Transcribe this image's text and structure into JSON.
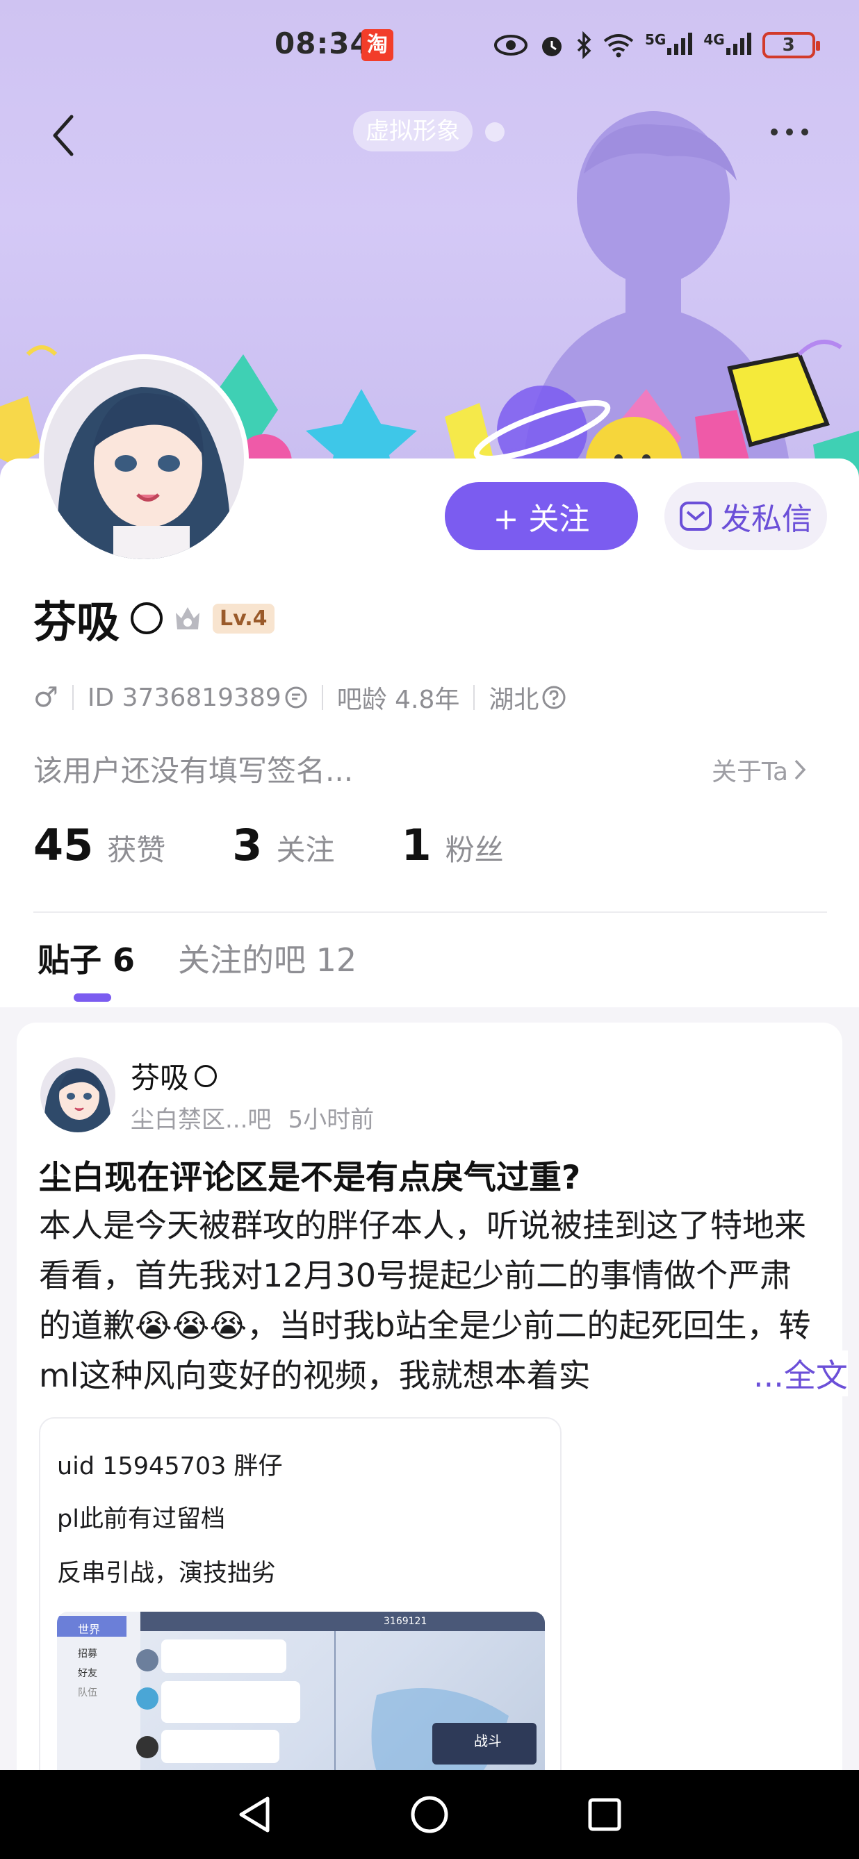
{
  "status_bar": {
    "time": "08:34",
    "taobao_icon_label": "淘",
    "network_5g": "5G",
    "network_4g": "4G",
    "battery_level": "3"
  },
  "header": {
    "avatar_chip_label": "虚拟形象"
  },
  "profile": {
    "follow_label": "+ 关注",
    "message_label": "发私信",
    "username": "芬吸",
    "level": "Lv.4",
    "gender_symbol": "♂",
    "id_text": "ID 3736819389",
    "bar_age": "吧龄 4.8年",
    "location": "湖北",
    "signature": "该用户还没有填写签名...",
    "about_label": "关于Ta",
    "stats": [
      {
        "value": "45",
        "label": "获赞"
      },
      {
        "value": "3",
        "label": "关注"
      },
      {
        "value": "1",
        "label": "粉丝"
      }
    ]
  },
  "tabs": [
    {
      "label": "贴子 6",
      "active": true
    },
    {
      "label": "关注的吧 12",
      "active": false
    }
  ],
  "post": {
    "author": "芬吸",
    "forum": "尘白禁区...吧",
    "time_ago": "5小时前",
    "title": "尘白现在评论区是不是有点戾气过重?",
    "body": "本人是今天被群攻的胖仔本人，听说被挂到这了特地来看看，首先我对12月30号提起少前二的事情做个严肃的道歉😭😭😭，当时我b站全是少前二的起死回生，转ml这种风向变好的视频，我就想本着实",
    "more_label": "...全文",
    "quote_lines": [
      "uid 15945703 胖仔",
      "pl此前有过留档",
      "反串引战，演技拙劣"
    ],
    "screenshot_labels": {
      "menu_1": "世界",
      "menu_2": "招募",
      "menu_3": "好友",
      "menu_4": "队伍",
      "battle": "战斗",
      "number": "3169121"
    }
  },
  "colors": {
    "accent": "#7b5cf0",
    "banner_top": "#cfc3f2",
    "level_badge_bg": "#f8e4cf"
  }
}
